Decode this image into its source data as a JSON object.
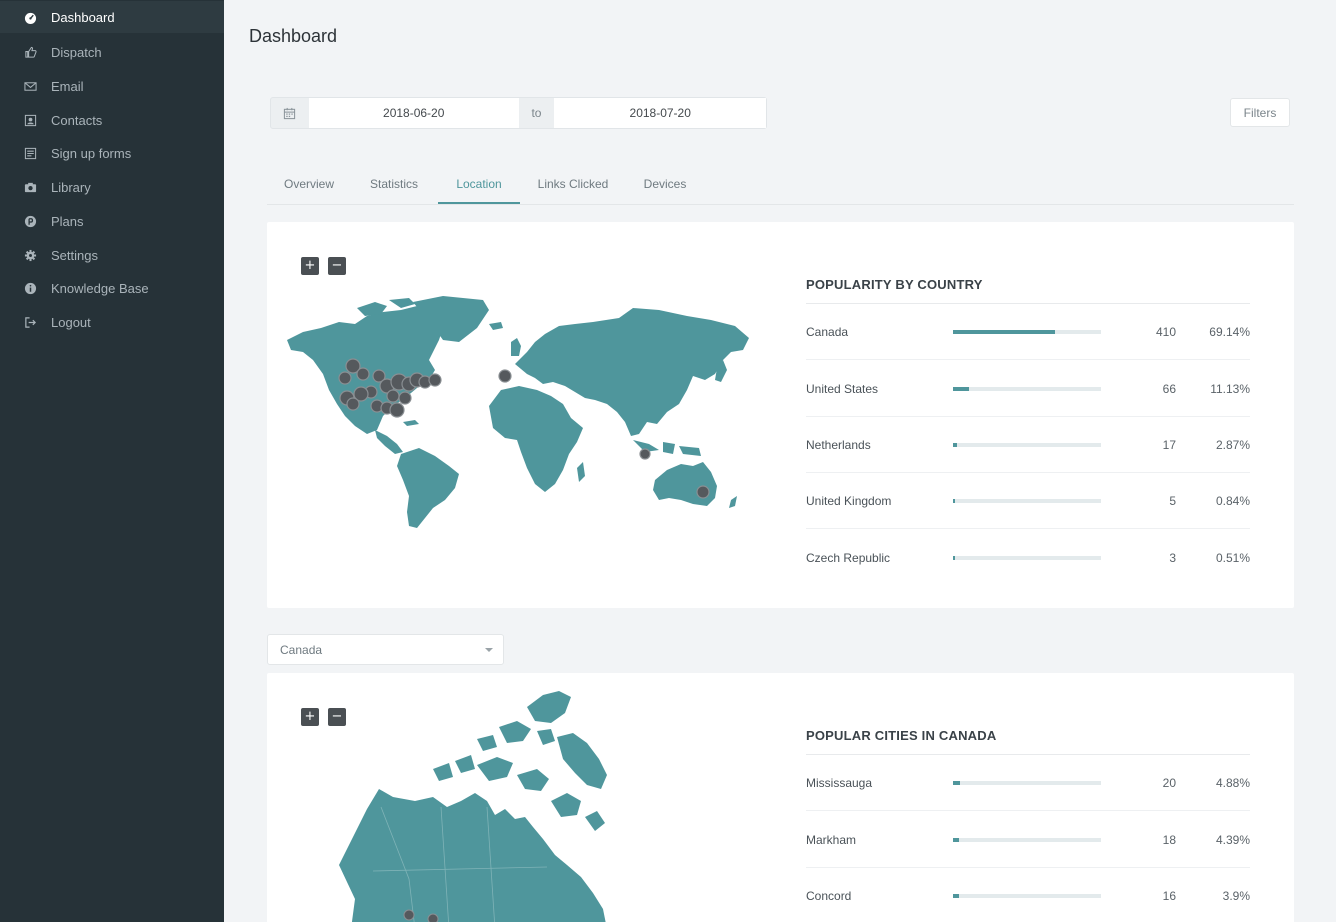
{
  "sidebar": {
    "items": [
      {
        "label": "Dashboard",
        "icon": "dashboard-icon",
        "active": true
      },
      {
        "label": "Dispatch",
        "icon": "thumbs-up-icon"
      },
      {
        "label": "Email",
        "icon": "envelope-icon"
      },
      {
        "label": "Contacts",
        "icon": "contact-card-icon"
      },
      {
        "label": "Sign up forms",
        "icon": "form-icon"
      },
      {
        "label": "Library",
        "icon": "camera-icon"
      },
      {
        "label": "Plans",
        "icon": "plan-coin-icon"
      },
      {
        "label": "Settings",
        "icon": "gear-icon"
      },
      {
        "label": "Knowledge Base",
        "icon": "info-icon"
      },
      {
        "label": "Logout",
        "icon": "logout-icon"
      }
    ]
  },
  "header": {
    "title": "Dashboard"
  },
  "date_range": {
    "from": "2018-06-20",
    "to_label": "to",
    "to": "2018-07-20",
    "calendar_icon": "calendar-icon"
  },
  "filters": {
    "label": "Filters"
  },
  "tabs": [
    {
      "label": "Overview"
    },
    {
      "label": "Statistics"
    },
    {
      "label": "Location",
      "active": true
    },
    {
      "label": "Links Clicked"
    },
    {
      "label": "Devices"
    }
  ],
  "zoom": {
    "in": "+",
    "out": "−"
  },
  "country_stats": {
    "title": "POPULARITY BY COUNTRY",
    "rows": [
      {
        "name": "Canada",
        "count": "410",
        "percent": "69.14%",
        "fraction": 0.6914
      },
      {
        "name": "United States",
        "count": "66",
        "percent": "11.13%",
        "fraction": 0.1113
      },
      {
        "name": "Netherlands",
        "count": "17",
        "percent": "2.87%",
        "fraction": 0.0287
      },
      {
        "name": "United Kingdom",
        "count": "5",
        "percent": "0.84%",
        "fraction": 0.0084
      },
      {
        "name": "Czech Republic",
        "count": "3",
        "percent": "0.51%",
        "fraction": 0.0051
      }
    ]
  },
  "country_select": {
    "value": "Canada"
  },
  "city_stats": {
    "title": "POPULAR CITIES IN CANADA",
    "rows": [
      {
        "name": "Mississauga",
        "count": "20",
        "percent": "4.88%",
        "fraction": 0.0488
      },
      {
        "name": "Markham",
        "count": "18",
        "percent": "4.39%",
        "fraction": 0.0439
      },
      {
        "name": "Concord",
        "count": "16",
        "percent": "3.9%",
        "fraction": 0.039
      }
    ]
  },
  "colors": {
    "sidebar_bg": "#263238",
    "accent": "#4f969c",
    "map_fill": "#4f969c",
    "marker": "#55595d"
  }
}
